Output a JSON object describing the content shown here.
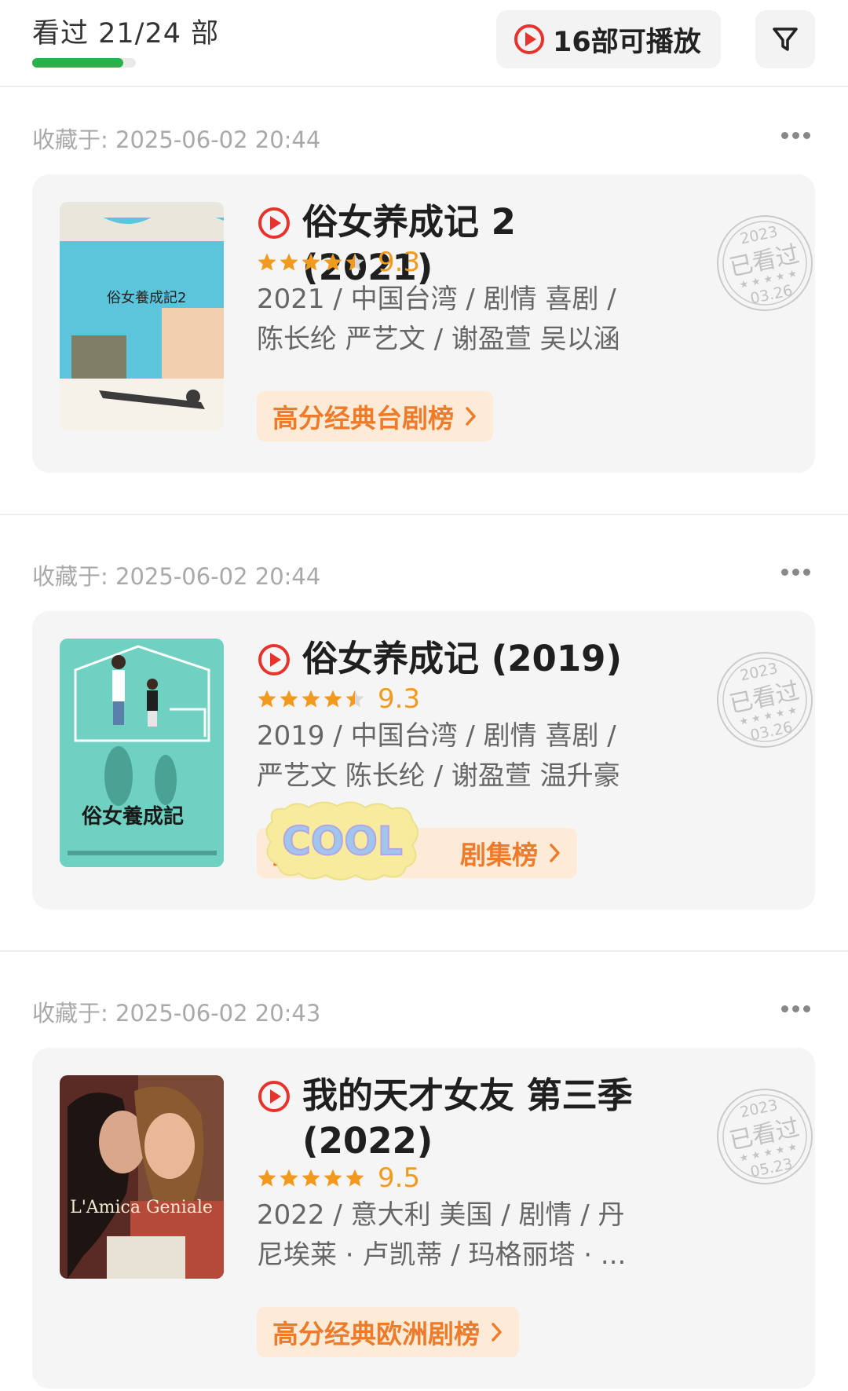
{
  "header": {
    "watched_text": "看过 21/24 部",
    "progress_fraction": 0.875,
    "play_button_label": "16部可播放",
    "play_icon": "play-circle-icon",
    "filter_icon": "filter-icon"
  },
  "accent_colors": {
    "play_red": "#e8322c",
    "star_orange": "#f29a1e",
    "progress_green": "#2ab24a",
    "chip_text": "#ee7b29"
  },
  "items": [
    {
      "saved_at": "收藏于: 2025-06-02 20:44",
      "title": "俗女养成记 2 (2021)",
      "stars": 4.5,
      "score": "9.3",
      "meta_line1": "2021 / 中国台湾 / 剧情 喜剧 /",
      "meta_line2": "陈长纶 严艺文 / 谢盈萱 吴以涵",
      "chip_label": "高分经典台剧榜",
      "stamp_year": "2023",
      "stamp_text": "已看过",
      "stamp_date": "03.26",
      "poster_title": "俗女養成記2"
    },
    {
      "saved_at": "收藏于: 2025-06-02 20:44",
      "title": "俗女养成记 (2019)",
      "stars": 4.5,
      "score": "9.3",
      "meta_line1": "2019 / 中国台湾 / 剧情 喜剧 /",
      "meta_line2": "严艺文 陈长纶 / 谢盈萱 温升豪",
      "chip_label_prefix": "豆",
      "chip_label_suffix": "剧集榜",
      "sticker_text": "COOL",
      "stamp_year": "2023",
      "stamp_text": "已看过",
      "stamp_date": "03.26",
      "poster_title": "俗女養成記"
    },
    {
      "saved_at": "收藏于: 2025-06-02 20:43",
      "title": "我的天才女友 第三季 (2022)",
      "stars": 5,
      "score": "9.5",
      "meta_line1": "2022 / 意大利 美国 / 剧情 / 丹",
      "meta_line2": "尼埃莱 · 卢凯蒂 / 玛格丽塔 · ...",
      "chip_label": "高分经典欧洲剧榜",
      "stamp_year": "2023",
      "stamp_text": "已看过",
      "stamp_date": "05.23",
      "poster_title": "L'Amica Geniale"
    }
  ]
}
